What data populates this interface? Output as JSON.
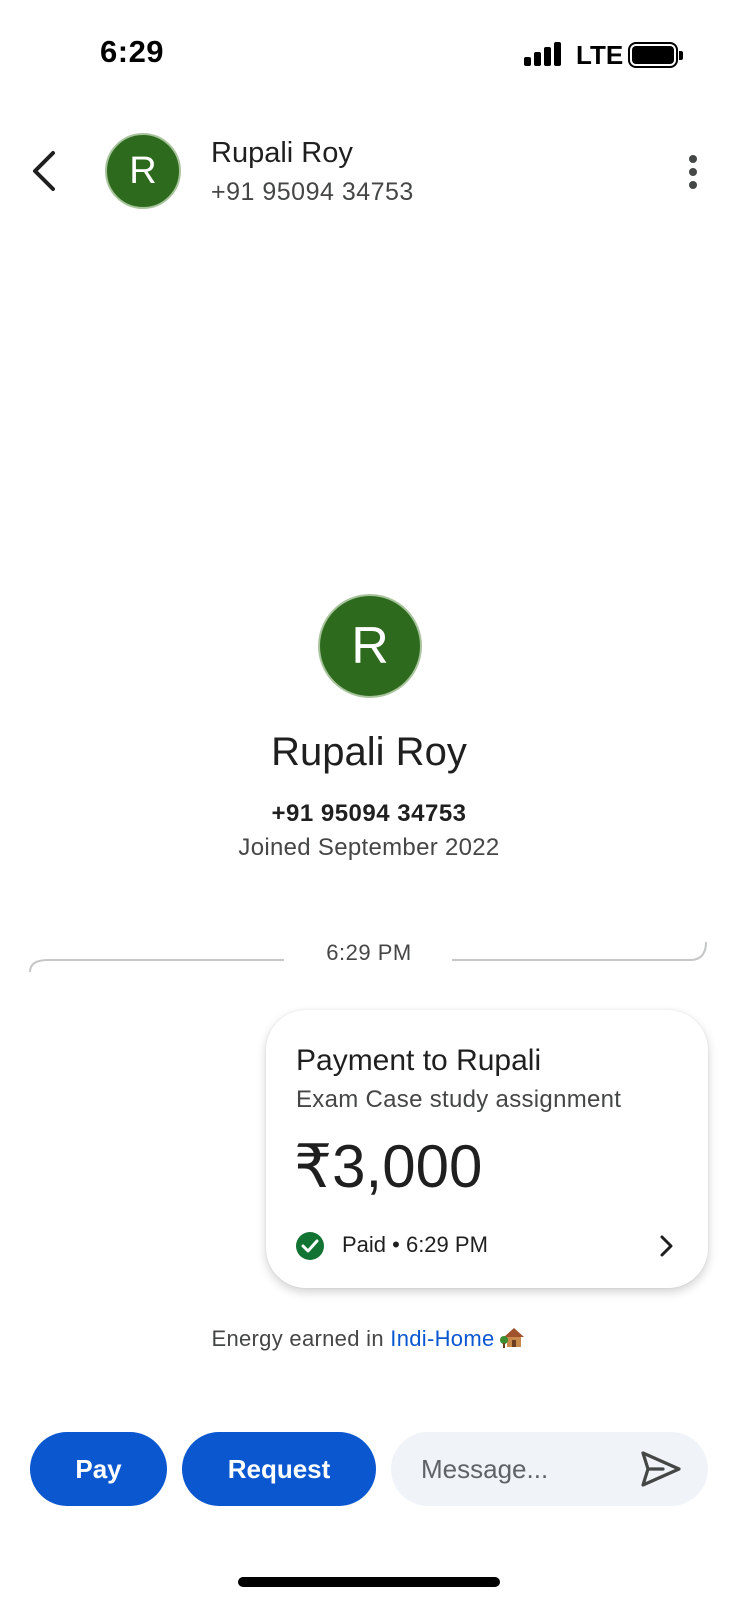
{
  "status_bar": {
    "time": "6:29",
    "network": "LTE"
  },
  "header": {
    "avatar_initial": "R",
    "name": "Rupali Roy",
    "phone": "+91 95094 34753",
    "back_icon": "chevron-left-icon",
    "more_icon": "more-vert-icon"
  },
  "profile": {
    "avatar_initial": "R",
    "name": "Rupali Roy",
    "phone": "+91 95094 34753",
    "joined": "Joined September 2022"
  },
  "timeline": {
    "timestamp": "6:29 PM"
  },
  "payment_card": {
    "title": "Payment to Rupali",
    "note": "Exam Case study assignment",
    "amount": "₹3,000",
    "status": "Paid • 6:29 PM"
  },
  "energy": {
    "prefix": "Energy earned in ",
    "link": "Indi-Home"
  },
  "actions": {
    "pay_label": "Pay",
    "request_label": "Request",
    "message_placeholder": "Message..."
  },
  "colors": {
    "avatar_bg": "#2d6a1e",
    "primary_blue": "#0b57d0",
    "paid_green": "#137333",
    "input_bg": "#f0f4f9"
  }
}
